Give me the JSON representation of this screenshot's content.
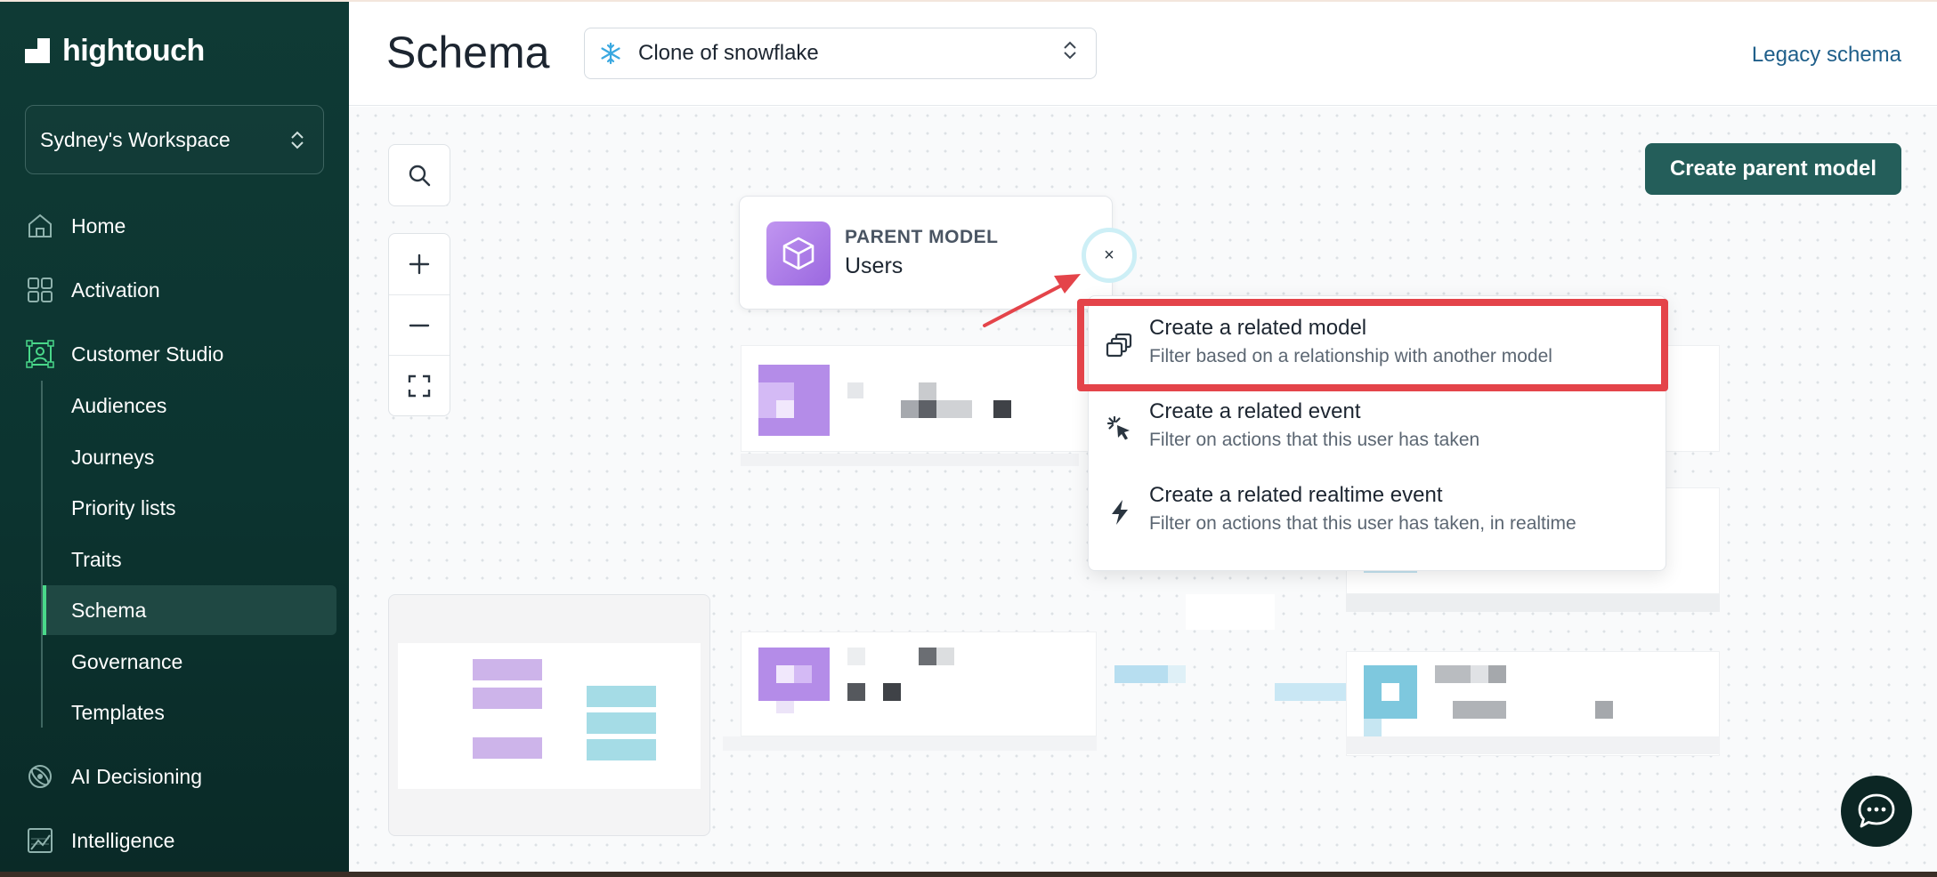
{
  "brand": {
    "name": "hightouch"
  },
  "workspace": {
    "name": "Sydney's Workspace"
  },
  "nav": {
    "home": "Home",
    "activation": "Activation",
    "customer_studio": "Customer Studio",
    "sub": [
      "Audiences",
      "Journeys",
      "Priority lists",
      "Traits",
      "Schema",
      "Governance",
      "Templates"
    ],
    "ai_decisioning": "AI Decisioning",
    "intelligence": "Intelligence"
  },
  "header": {
    "title": "Schema",
    "source": "Clone of snowflake",
    "legacy_link": "Legacy schema"
  },
  "canvas": {
    "create_parent_button": "Create parent model",
    "parent_card": {
      "label": "PARENT MODEL",
      "name": "Users"
    },
    "close_symbol": "×"
  },
  "menu": {
    "items": [
      {
        "title": "Create a related model",
        "desc": "Filter based on a relationship with another model",
        "icon": "related-model-icon"
      },
      {
        "title": "Create a related event",
        "desc": "Filter on actions that this user has taken",
        "icon": "click-cursor-icon"
      },
      {
        "title": "Create a related realtime event",
        "desc": "Filter on actions that this user has taken, in realtime",
        "icon": "lightning-icon"
      }
    ]
  },
  "colors": {
    "sidebar": "#0f3a35",
    "accent": "#245e5a",
    "active_indicator": "#49d88a",
    "highlight": "#e4444a",
    "parent_model": "#a678e6",
    "event_model": "#7ec8de"
  }
}
